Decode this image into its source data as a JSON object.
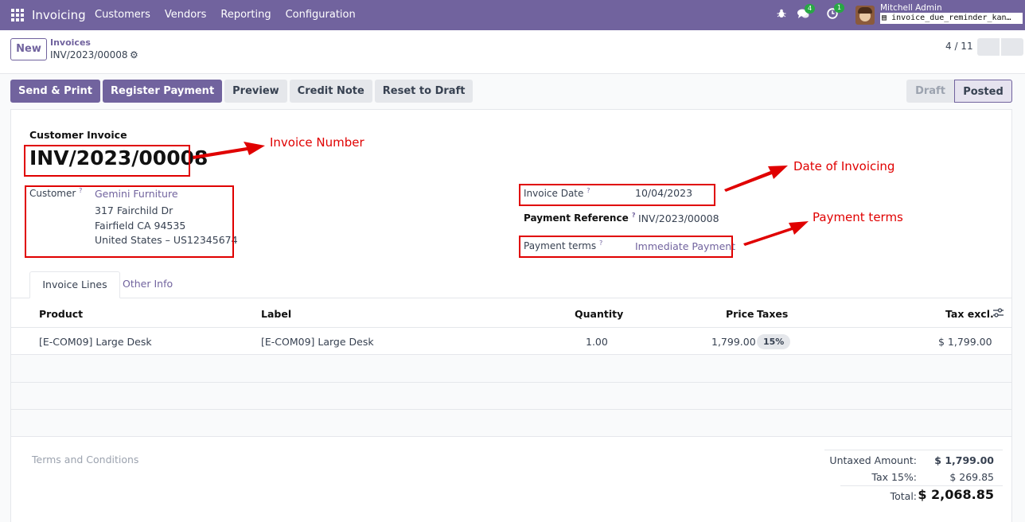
{
  "navbar": {
    "app_name": "Invoicing",
    "menu": [
      "Customers",
      "Vendors",
      "Reporting",
      "Configuration"
    ],
    "messages_count": "4",
    "activities_count": "1",
    "user_name": "Mitchell Admin",
    "database": "invoice_due_reminder_kan…"
  },
  "control": {
    "new_label": "New",
    "breadcrumb_parent": "Invoices",
    "breadcrumb_current": "INV/2023/00008",
    "pager": "4 / 11"
  },
  "actions": {
    "send_print": "Send & Print",
    "register_payment": "Register Payment",
    "preview": "Preview",
    "credit_note": "Credit Note",
    "reset_draft": "Reset to Draft"
  },
  "status": {
    "draft": "Draft",
    "posted": "Posted"
  },
  "invoice": {
    "type": "Customer Invoice",
    "number": "INV/2023/00008",
    "customer_label": "Customer",
    "customer_name": "Gemini Furniture",
    "address_line1": "317 Fairchild Dr",
    "address_line2": "Fairfield CA 94535",
    "address_line3": "United States – US12345674",
    "date_label": "Invoice Date",
    "date_value": "10/04/2023",
    "payref_label": "Payment Reference",
    "payref_value": "INV/2023/00008",
    "terms_label": "Payment terms",
    "terms_value": "Immediate Payment",
    "help_mark": "?"
  },
  "annotations": {
    "invoice_number": "Invoice Number",
    "invoice_date": "Date of Invoicing",
    "payment_terms": "Payment terms"
  },
  "tabs": {
    "lines": "Invoice Lines",
    "other": "Other Info"
  },
  "table": {
    "headers": {
      "product": "Product",
      "label": "Label",
      "quantity": "Quantity",
      "price": "Price",
      "taxes": "Taxes",
      "subtotal": "Tax excl."
    },
    "rows": [
      {
        "product": "[E-COM09] Large Desk",
        "label": "[E-COM09] Large Desk",
        "quantity": "1.00",
        "price": "1,799.00",
        "tax": "15%",
        "subtotal": "$ 1,799.00"
      }
    ]
  },
  "totals": {
    "terms_placeholder": "Terms and Conditions",
    "untaxed_label": "Untaxed Amount:",
    "untaxed_value": "$ 1,799.00",
    "tax_label": "Tax 15%:",
    "tax_value": "$ 269.85",
    "total_label": "Total:",
    "total_value": "$ 2,068.85"
  },
  "colors": {
    "brand": "#71639e",
    "annotation": "#e00000",
    "badge": "#28a745"
  }
}
